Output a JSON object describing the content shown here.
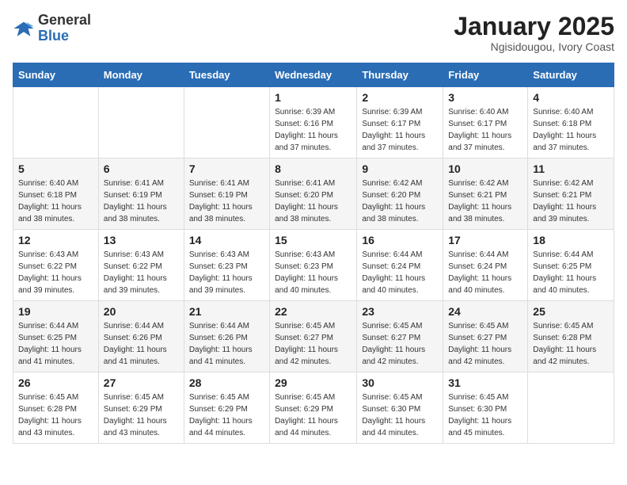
{
  "header": {
    "logo_general": "General",
    "logo_blue": "Blue",
    "title": "January 2025",
    "location": "Ngisidougou, Ivory Coast"
  },
  "days_of_week": [
    "Sunday",
    "Monday",
    "Tuesday",
    "Wednesday",
    "Thursday",
    "Friday",
    "Saturday"
  ],
  "weeks": [
    [
      {
        "day": "",
        "info": ""
      },
      {
        "day": "",
        "info": ""
      },
      {
        "day": "",
        "info": ""
      },
      {
        "day": "1",
        "info": "Sunrise: 6:39 AM\nSunset: 6:16 PM\nDaylight: 11 hours and 37 minutes."
      },
      {
        "day": "2",
        "info": "Sunrise: 6:39 AM\nSunset: 6:17 PM\nDaylight: 11 hours and 37 minutes."
      },
      {
        "day": "3",
        "info": "Sunrise: 6:40 AM\nSunset: 6:17 PM\nDaylight: 11 hours and 37 minutes."
      },
      {
        "day": "4",
        "info": "Sunrise: 6:40 AM\nSunset: 6:18 PM\nDaylight: 11 hours and 37 minutes."
      }
    ],
    [
      {
        "day": "5",
        "info": "Sunrise: 6:40 AM\nSunset: 6:18 PM\nDaylight: 11 hours and 38 minutes."
      },
      {
        "day": "6",
        "info": "Sunrise: 6:41 AM\nSunset: 6:19 PM\nDaylight: 11 hours and 38 minutes."
      },
      {
        "day": "7",
        "info": "Sunrise: 6:41 AM\nSunset: 6:19 PM\nDaylight: 11 hours and 38 minutes."
      },
      {
        "day": "8",
        "info": "Sunrise: 6:41 AM\nSunset: 6:20 PM\nDaylight: 11 hours and 38 minutes."
      },
      {
        "day": "9",
        "info": "Sunrise: 6:42 AM\nSunset: 6:20 PM\nDaylight: 11 hours and 38 minutes."
      },
      {
        "day": "10",
        "info": "Sunrise: 6:42 AM\nSunset: 6:21 PM\nDaylight: 11 hours and 38 minutes."
      },
      {
        "day": "11",
        "info": "Sunrise: 6:42 AM\nSunset: 6:21 PM\nDaylight: 11 hours and 39 minutes."
      }
    ],
    [
      {
        "day": "12",
        "info": "Sunrise: 6:43 AM\nSunset: 6:22 PM\nDaylight: 11 hours and 39 minutes."
      },
      {
        "day": "13",
        "info": "Sunrise: 6:43 AM\nSunset: 6:22 PM\nDaylight: 11 hours and 39 minutes."
      },
      {
        "day": "14",
        "info": "Sunrise: 6:43 AM\nSunset: 6:23 PM\nDaylight: 11 hours and 39 minutes."
      },
      {
        "day": "15",
        "info": "Sunrise: 6:43 AM\nSunset: 6:23 PM\nDaylight: 11 hours and 40 minutes."
      },
      {
        "day": "16",
        "info": "Sunrise: 6:44 AM\nSunset: 6:24 PM\nDaylight: 11 hours and 40 minutes."
      },
      {
        "day": "17",
        "info": "Sunrise: 6:44 AM\nSunset: 6:24 PM\nDaylight: 11 hours and 40 minutes."
      },
      {
        "day": "18",
        "info": "Sunrise: 6:44 AM\nSunset: 6:25 PM\nDaylight: 11 hours and 40 minutes."
      }
    ],
    [
      {
        "day": "19",
        "info": "Sunrise: 6:44 AM\nSunset: 6:25 PM\nDaylight: 11 hours and 41 minutes."
      },
      {
        "day": "20",
        "info": "Sunrise: 6:44 AM\nSunset: 6:26 PM\nDaylight: 11 hours and 41 minutes."
      },
      {
        "day": "21",
        "info": "Sunrise: 6:44 AM\nSunset: 6:26 PM\nDaylight: 11 hours and 41 minutes."
      },
      {
        "day": "22",
        "info": "Sunrise: 6:45 AM\nSunset: 6:27 PM\nDaylight: 11 hours and 42 minutes."
      },
      {
        "day": "23",
        "info": "Sunrise: 6:45 AM\nSunset: 6:27 PM\nDaylight: 11 hours and 42 minutes."
      },
      {
        "day": "24",
        "info": "Sunrise: 6:45 AM\nSunset: 6:27 PM\nDaylight: 11 hours and 42 minutes."
      },
      {
        "day": "25",
        "info": "Sunrise: 6:45 AM\nSunset: 6:28 PM\nDaylight: 11 hours and 42 minutes."
      }
    ],
    [
      {
        "day": "26",
        "info": "Sunrise: 6:45 AM\nSunset: 6:28 PM\nDaylight: 11 hours and 43 minutes."
      },
      {
        "day": "27",
        "info": "Sunrise: 6:45 AM\nSunset: 6:29 PM\nDaylight: 11 hours and 43 minutes."
      },
      {
        "day": "28",
        "info": "Sunrise: 6:45 AM\nSunset: 6:29 PM\nDaylight: 11 hours and 44 minutes."
      },
      {
        "day": "29",
        "info": "Sunrise: 6:45 AM\nSunset: 6:29 PM\nDaylight: 11 hours and 44 minutes."
      },
      {
        "day": "30",
        "info": "Sunrise: 6:45 AM\nSunset: 6:30 PM\nDaylight: 11 hours and 44 minutes."
      },
      {
        "day": "31",
        "info": "Sunrise: 6:45 AM\nSunset: 6:30 PM\nDaylight: 11 hours and 45 minutes."
      },
      {
        "day": "",
        "info": ""
      }
    ]
  ]
}
